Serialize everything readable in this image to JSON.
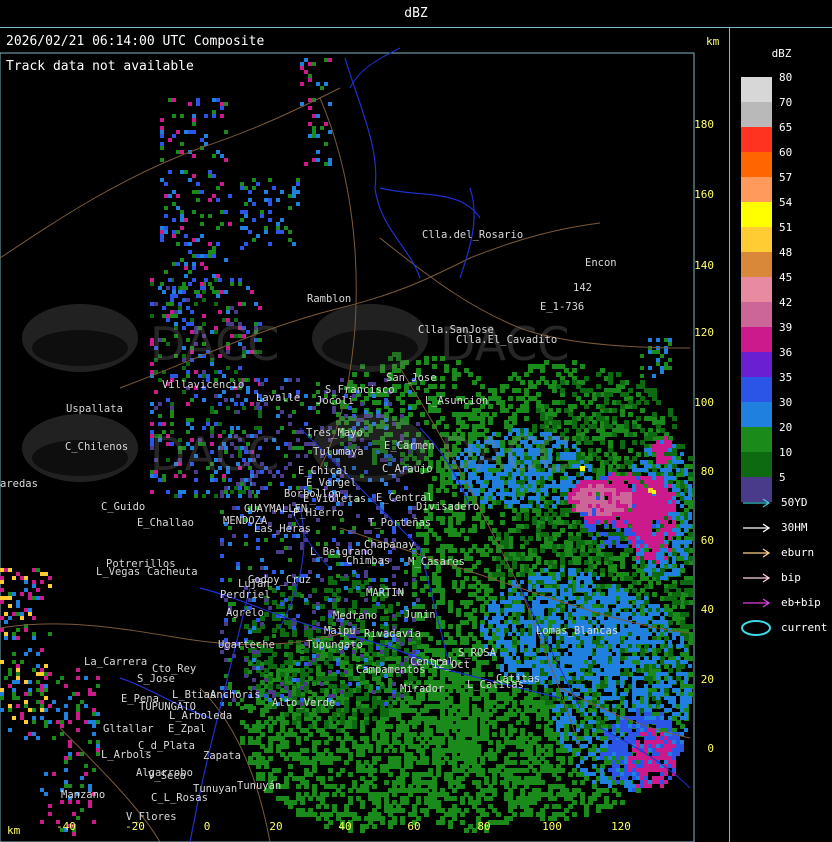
{
  "header": {
    "title": "dBZ"
  },
  "map": {
    "timestamp": "2026/02/21 06:14:00 UTC Composite",
    "track_notice": "Track data not available",
    "unit_top": "km",
    "unit_bottom": "km",
    "x_ticks": [
      "-40",
      "-20",
      "0",
      "20",
      "40",
      "60",
      "80",
      "100",
      "120"
    ],
    "y_ticks": [
      "180",
      "160",
      "140",
      "120",
      "100",
      "80",
      "60",
      "40",
      "20",
      "0"
    ],
    "watermark": "DACC",
    "places": [
      "Clla.del_Rosario",
      "Encon",
      "E_1-736",
      "142",
      "Ramblon",
      "Clla.SanJose",
      "Clla.El_Cavadito",
      "San_Jose",
      "L_Asuncion",
      "S_Francisco",
      "Jocoli",
      "Lavalle",
      "Villavicencio",
      "Uspallata",
      "C_Chilenos",
      "aredas",
      "Tres_Mayo",
      "Tulumaya",
      "E_Carmen",
      "E_Chical",
      "E_Vergel",
      "Borbollon",
      "E_Violetas",
      "E_Central",
      "C_Araujo",
      "Divisadero",
      "P_Hierro",
      "T_Porteñas",
      "C_Guido",
      "E_Challao",
      "MENDOZA",
      "GUAYMALLEN",
      "Chapanay",
      "L_Belgrano",
      "Chimbas",
      "M_Casares",
      "Potrerillos",
      "Cacheuta",
      "L_Vegas",
      "Luján",
      "Perdriel",
      "MARTIN",
      "Agrelo",
      "Medrano",
      "Ugarteche",
      "Lomas_Blancas",
      "S_ROSA",
      "12_Oct",
      "L_Catitas",
      "La_Carrera",
      "Cto_Rey",
      "S_Jose",
      "E_Pena",
      "TUPUNGATO",
      "Anchoris",
      "L_Btias",
      "L_Arboleda",
      "Gltallar",
      "E_Zpal",
      "C_d_Plata",
      "L_Arbols",
      "Zapata",
      "Algarrobo",
      "V_Seco",
      "Tunuyan",
      "Manzano",
      "C_L_Rosas",
      "V_Flores",
      "Rivadavia",
      "Junin",
      "Campamentos",
      "Central",
      "Mirador",
      "Catitas",
      "Tupungato",
      "Las_Heras",
      "Godoy_Cruz",
      "Maipu",
      "Tunuyán",
      "Alto_Verde"
    ]
  },
  "legend": {
    "title": "dBZ",
    "scale": [
      {
        "value": "80",
        "color": "#d7d7d7"
      },
      {
        "value": "70",
        "color": "#b9b9b9"
      },
      {
        "value": "65",
        "color": "#ff3320"
      },
      {
        "value": "60",
        "color": "#ff6600"
      },
      {
        "value": "57",
        "color": "#ff9a5c"
      },
      {
        "value": "54",
        "color": "#ffff00"
      },
      {
        "value": "51",
        "color": "#ffcc33"
      },
      {
        "value": "48",
        "color": "#d9883a"
      },
      {
        "value": "45",
        "color": "#e88aa0"
      },
      {
        "value": "42",
        "color": "#cc6699"
      },
      {
        "value": "39",
        "color": "#cc1a8c"
      },
      {
        "value": "36",
        "color": "#6a1fd0"
      },
      {
        "value": "35",
        "color": "#2b55e6"
      },
      {
        "value": "30",
        "color": "#2080e0"
      },
      {
        "value": "20",
        "color": "#1a8a1a"
      },
      {
        "value": "10",
        "color": "#0e6a10"
      },
      {
        "value": "5",
        "color": "#4a3a8a"
      }
    ],
    "tracks": [
      {
        "label": "50YD",
        "color": "#3cc8d8"
      },
      {
        "label": "30HM",
        "color": "#ffffff"
      },
      {
        "label": "eburn",
        "color": "#ffd08a"
      },
      {
        "label": "bip",
        "color": "#ffd0e0"
      },
      {
        "label": "eb+bip",
        "color": "#e040e0"
      },
      {
        "label": "current",
        "color": "#40d8e8"
      }
    ]
  }
}
